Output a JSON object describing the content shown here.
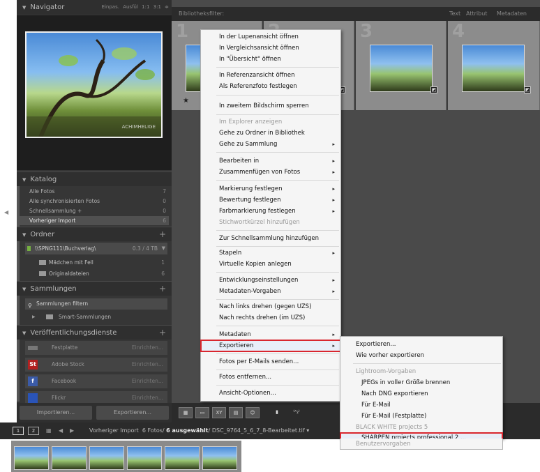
{
  "navigator": {
    "title": "Navigator",
    "options": "Einpas.  Ausfül  1:1  3:1 ≑",
    "watermark": "ACHIMHELIGE"
  },
  "katalog": {
    "title": "Katalog",
    "items": [
      {
        "label": "Alle Fotos",
        "count": "7"
      },
      {
        "label": "Alle synchronisierten Fotos",
        "count": "0"
      },
      {
        "label": "Schnellsammlung +",
        "count": "0"
      },
      {
        "label": "Vorheriger Import",
        "count": "6"
      }
    ]
  },
  "ordner": {
    "title": "Ordner",
    "plus": "+",
    "drive": {
      "label": "\\\\SPNG111\\Buchverlag\\",
      "capacity": "0.3 / 4 TB"
    },
    "folders": [
      {
        "label": "Mädchen mit Fell",
        "count": "1"
      },
      {
        "label": "Originaldateien",
        "count": "6"
      }
    ]
  },
  "sammlungen": {
    "title": "Sammlungen",
    "plus": "+",
    "filter": "Sammlungen filtern",
    "smart": "Smart-Sammlungen"
  },
  "publish": {
    "title": "Veröffentlichungsdienste",
    "plus": "+",
    "services": [
      {
        "label": "Festplatte",
        "icon": "",
        "action": "Einrichten..."
      },
      {
        "label": "Adobe Stock",
        "icon": "St",
        "action": "Einrichten..."
      },
      {
        "label": "Facebook",
        "icon": "f",
        "action": "Einrichten..."
      },
      {
        "label": "Flickr",
        "icon": "",
        "action": "Einrichten..."
      }
    ]
  },
  "buttons": {
    "import": "Importieren...",
    "export": "Exportieren..."
  },
  "filterbar": {
    "label": "Bibliotheksfilter:",
    "text": "Text",
    "attribut": "Attribut",
    "metadaten": "Metadaten"
  },
  "grid": {
    "numbers": [
      "1",
      "2",
      "3",
      "4"
    ]
  },
  "toolbar": {
    "sort_glyph": "⁽ᴬ₂⁾"
  },
  "filmbar": {
    "page1": "1",
    "page2": "2",
    "source": "Vorheriger Import",
    "count": "6 Fotos/",
    "selected": "6 ausgewählt",
    "file": "/ DSC_9764_5_6_7_8-Bearbeitet.tif ▾"
  },
  "context_menu": {
    "items": [
      {
        "label": "In der Lupenansicht öffnen",
        "sub": "",
        "dis": false
      },
      {
        "label": "In Vergleichsansicht öffnen",
        "sub": "",
        "dis": false
      },
      {
        "label": "In \"Übersicht\" öffnen",
        "sub": "",
        "dis": false
      },
      {
        "label": "In Referenzansicht öffnen",
        "sub": "",
        "dis": false
      },
      {
        "label": "Als Referenzfoto festlegen",
        "sub": "",
        "dis": false
      },
      {
        "label": "In zweitem Bildschirm sperren",
        "sub": "",
        "dis": false
      },
      {
        "label": "Im Explorer anzeigen",
        "sub": "",
        "dis": true
      },
      {
        "label": "Gehe zu Ordner in Bibliothek",
        "sub": "",
        "dis": false
      },
      {
        "label": "Gehe zu Sammlung",
        "sub": "▸",
        "dis": false
      },
      {
        "label": "Bearbeiten in",
        "sub": "▸",
        "dis": false
      },
      {
        "label": "Zusammenfügen von Fotos",
        "sub": "▸",
        "dis": false
      },
      {
        "label": "Markierung festlegen",
        "sub": "▸",
        "dis": false
      },
      {
        "label": "Bewertung festlegen",
        "sub": "▸",
        "dis": false
      },
      {
        "label": "Farbmarkierung festlegen",
        "sub": "▸",
        "dis": false
      },
      {
        "label": "Stichwortkürzel hinzufügen",
        "sub": "",
        "dis": true
      },
      {
        "label": "Zur Schnellsammlung hinzufügen",
        "sub": "",
        "dis": false
      },
      {
        "label": "Stapeln",
        "sub": "▸",
        "dis": false
      },
      {
        "label": "Virtuelle Kopien anlegen",
        "sub": "",
        "dis": false
      },
      {
        "label": "Entwicklungseinstellungen",
        "sub": "▸",
        "dis": false
      },
      {
        "label": "Metadaten-Vorgaben",
        "sub": "▸",
        "dis": false
      },
      {
        "label": "Nach links drehen (gegen UZS)",
        "sub": "",
        "dis": false
      },
      {
        "label": "Nach rechts drehen (im UZS)",
        "sub": "",
        "dis": false
      },
      {
        "label": "Metadaten",
        "sub": "▸",
        "dis": false
      },
      {
        "label": "Exportieren",
        "sub": "▸",
        "dis": false
      },
      {
        "label": "Fotos per E-Mails senden...",
        "sub": "",
        "dis": false
      },
      {
        "label": "Fotos entfernen...",
        "sub": "",
        "dis": false
      },
      {
        "label": "Ansicht-Optionen...",
        "sub": "",
        "dis": false
      }
    ]
  },
  "export_submenu": {
    "items": [
      {
        "label": "Exportieren..."
      },
      {
        "label": "Wie vorher exportieren"
      },
      {
        "label": "Lightroom-Vorgaben"
      },
      {
        "label": "JPEGs in voller Größe brennen"
      },
      {
        "label": "Nach DNG exportieren"
      },
      {
        "label": "Für E-Mail"
      },
      {
        "label": "Für E-Mail (Festplatte)"
      },
      {
        "label": "BLACK WHITE projects 5"
      },
      {
        "label": "SHARPEN projects professional 2 ..."
      },
      {
        "label": "Benutzervorgaben"
      }
    ]
  }
}
